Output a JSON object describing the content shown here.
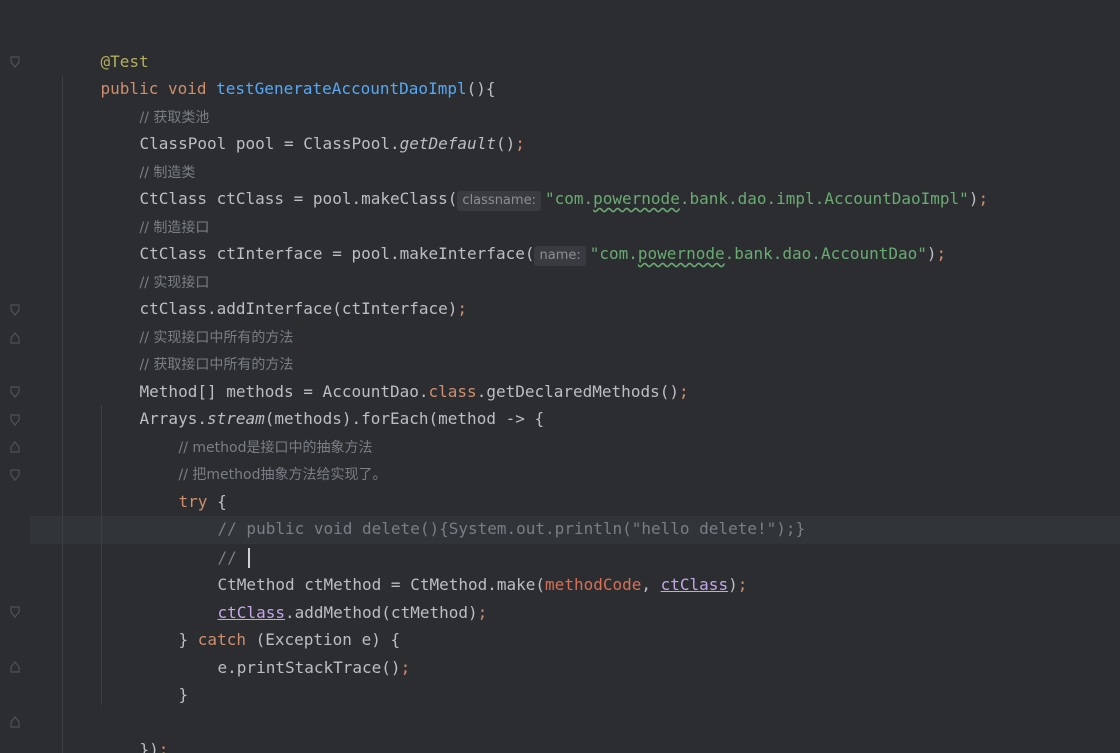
{
  "editor": {
    "lines": {
      "l1": {
        "annotation": "@Test"
      },
      "l2": {
        "kw": "public",
        "type": "void",
        "name": "testGenerateAccountDaoImpl",
        "rest": "(){"
      },
      "l3": {
        "comment": "// 获取类池"
      },
      "l4": {
        "a": "ClassPool pool = ClassPool.",
        "method": "getDefault",
        "b": "()",
        "semi": ";"
      },
      "l5": {
        "comment": "// 制造类"
      },
      "l6": {
        "a": "CtClass ctClass = pool.makeClass(",
        "hint": "classname:",
        "str_a": "\"com.",
        "str_sq": "powernode",
        "str_b": ".bank.dao.impl.AccountDaoImpl\"",
        "b": ")",
        "semi": ";"
      },
      "l7": {
        "comment": "// 制造接口"
      },
      "l8": {
        "a": "CtClass ctInterface = pool.makeInterface(",
        "hint": "name:",
        "str_a": "\"com.",
        "str_sq": "powernode",
        "str_b": ".bank.dao.AccountDao\"",
        "b": ")",
        "semi": ";"
      },
      "l9": {
        "comment": "// 实现接口"
      },
      "l10": {
        "a": "ctClass.addInterface(ctInterface)",
        "semi": ";"
      },
      "l11": {
        "comment": "// 实现接口中所有的方法"
      },
      "l12": {
        "comment": "// 获取接口中所有的方法"
      },
      "l13": {
        "a": "Method[] methods = AccountDao.",
        "kw": "class",
        "b": ".getDeclaredMethods()",
        "semi": ";"
      },
      "l14": {
        "a": "Arrays.",
        "method": "stream",
        "b": "(methods).forEach(method -> {"
      },
      "l15": {
        "comment": "// method是接口中的抽象方法"
      },
      "l16": {
        "comment": "// 把method抽象方法给实现了。"
      },
      "l17": {
        "kw": "try",
        "b": " {"
      },
      "l18": {
        "comment": "// public void delete(){System.out.println(\"hello delete!\");}"
      },
      "l19": {
        "comment": "// "
      },
      "l20": {
        "a": "CtMethod ctMethod = CtMethod.make(",
        "red": "methodCode",
        "sep": ", ",
        "ul": "ctClass",
        "b": ")",
        "semi": ";"
      },
      "l21": {
        "ul": "ctClass",
        "b": ".addMethod(ctMethod)",
        "semi": ";"
      },
      "l22": {
        "a": "} ",
        "kw": "catch",
        "b": " (Exception e) {"
      },
      "l23": {
        "a": "e.printStackTrace()",
        "semi": ";"
      },
      "l24": {
        "a": "}"
      },
      "l25": {
        "a": "})",
        "semi": ";"
      }
    }
  }
}
